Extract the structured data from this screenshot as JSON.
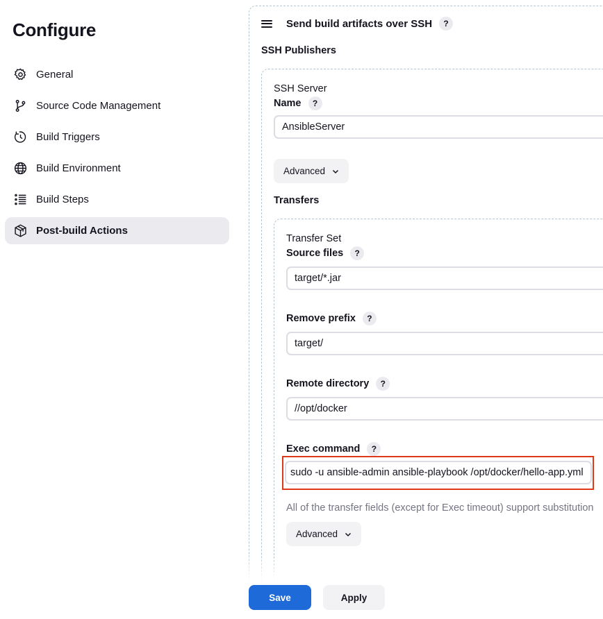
{
  "page": {
    "title": "Configure"
  },
  "sidebar": {
    "items": [
      {
        "label": "General",
        "icon": "gear-icon",
        "active": false
      },
      {
        "label": "Source Code Management",
        "icon": "git-branch-icon",
        "active": false
      },
      {
        "label": "Build Triggers",
        "icon": "clock-icon",
        "active": false
      },
      {
        "label": "Build Environment",
        "icon": "globe-icon",
        "active": false
      },
      {
        "label": "Build Steps",
        "icon": "list-icon",
        "active": false
      },
      {
        "label": "Post-build Actions",
        "icon": "package-icon",
        "active": true
      }
    ]
  },
  "section": {
    "title": "Send build artifacts over SSH",
    "help": "?",
    "publishers_label": "SSH Publishers",
    "server": {
      "heading": "SSH Server",
      "name_label": "Name",
      "name_value": "AnsibleServer",
      "advanced_label": "Advanced"
    },
    "transfers_label": "Transfers",
    "transfer_set": {
      "heading": "Transfer Set",
      "source_files_label": "Source files",
      "source_files_value": "target/*.jar",
      "remove_prefix_label": "Remove prefix",
      "remove_prefix_value": "target/",
      "remote_directory_label": "Remote directory",
      "remote_directory_value": "//opt/docker",
      "exec_command_label": "Exec command",
      "exec_command_value": "sudo -u ansible-admin ansible-playbook /opt/docker/hello-app.yml",
      "hint": "All of the transfer fields (except for Exec timeout) support substitution",
      "advanced_label": "Advanced"
    }
  },
  "footer": {
    "save_label": "Save",
    "apply_label": "Apply"
  },
  "colors": {
    "primary": "#1d6ad8",
    "highlight": "#e0371b",
    "active_bg": "#ebebef"
  }
}
